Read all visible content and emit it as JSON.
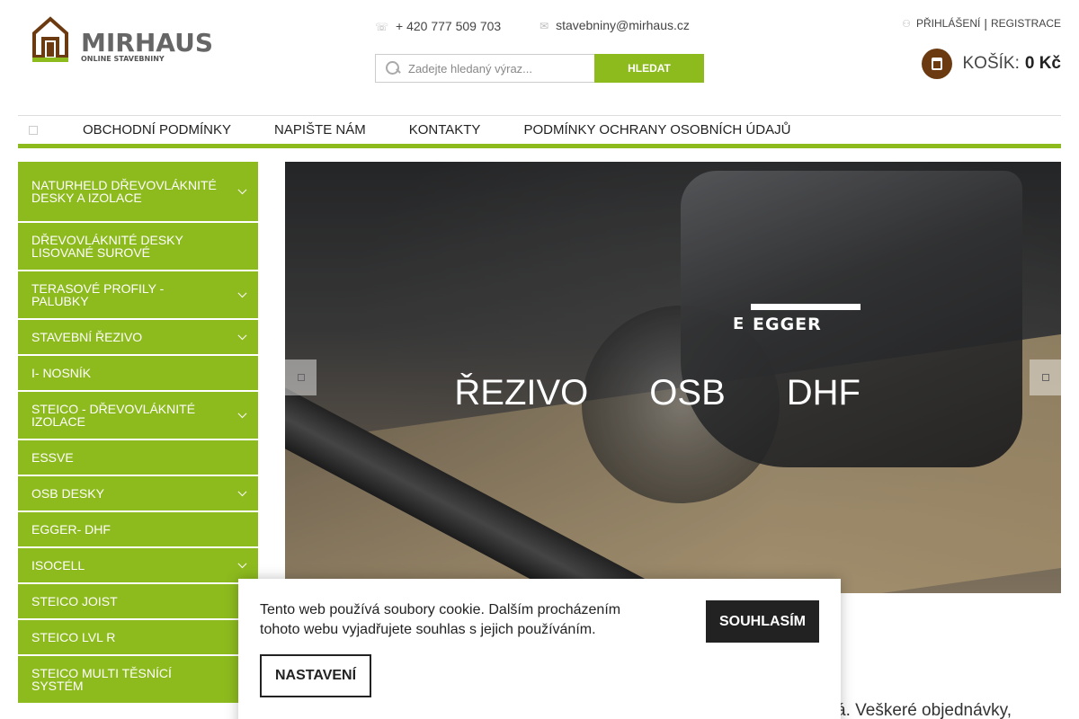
{
  "header": {
    "logo_text": "MIRHAUS",
    "logo_subtext": "ONLINE STAVEBNINY",
    "phone": "+ 420 777 509 703",
    "email": "stavebniny@mirhaus.cz",
    "login_label": "PŘIHLÁŠENÍ",
    "separator": "|",
    "register_label": "REGISTRACE",
    "search": {
      "placeholder": "Zadejte hledaný výraz...",
      "button_label": "HLEDAT"
    },
    "cart": {
      "label": "KOŠÍK:",
      "value": "0 Kč"
    },
    "colors": {
      "accent": "#8dbb1e",
      "cart_icon": "#6b3a10"
    }
  },
  "nav": {
    "home_icon": "home-icon",
    "items": [
      {
        "label": "OBCHODNÍ PODMÍNKY"
      },
      {
        "label": "NAPIŠTE NÁM"
      },
      {
        "label": "KONTAKTY"
      },
      {
        "label": "PODMÍNKY OCHRANY OSOBNÍCH ÚDAJŮ"
      }
    ]
  },
  "sidebar": {
    "categories": [
      {
        "label": "NATURHELD DŘEVOVLÁKNITÉ DESKY A IZOLACE",
        "has_submenu": true
      },
      {
        "label": "DŘEVOVLÁKNITÉ DESKY LISOVANÉ SUROVÉ",
        "has_submenu": false
      },
      {
        "label": "TERASOVÉ PROFILY - PALUBKY",
        "has_submenu": true
      },
      {
        "label": "STAVEBNÍ ŘEZIVO",
        "has_submenu": true
      },
      {
        "label": "I- NOSNÍK",
        "has_submenu": false
      },
      {
        "label": "STEICO - DŘEVOVLÁKNITÉ IZOLACE",
        "has_submenu": true
      },
      {
        "label": "ESSVE",
        "has_submenu": false
      },
      {
        "label": "OSB DESKY",
        "has_submenu": true
      },
      {
        "label": "EGGER- DHF",
        "has_submenu": false
      },
      {
        "label": "ISOCELL",
        "has_submenu": true
      },
      {
        "label": "STEICO JOIST",
        "has_submenu": false
      },
      {
        "label": "STEICO LVL R",
        "has_submenu": false
      },
      {
        "label": "STEICO MULTI TĚSNÍCÍ SYSTÉM",
        "has_submenu": false
      }
    ]
  },
  "banner": {
    "brand": "EGGER",
    "brand_mark": "E",
    "slogan": [
      "ŘEZIVO",
      "OSB",
      "DHF"
    ],
    "prev_icon": "arrow-left-icon",
    "next_icon": "arrow-right-icon"
  },
  "main": {
    "partial_text": "á. Veškeré objednávky,"
  },
  "cookie": {
    "text": "Tento web používá soubory cookie. Dalším procházením tohoto webu vyjadřujete souhlas s jejich používáním.",
    "agree_label": "SOUHLASÍM",
    "settings_label": "NASTAVENÍ"
  }
}
